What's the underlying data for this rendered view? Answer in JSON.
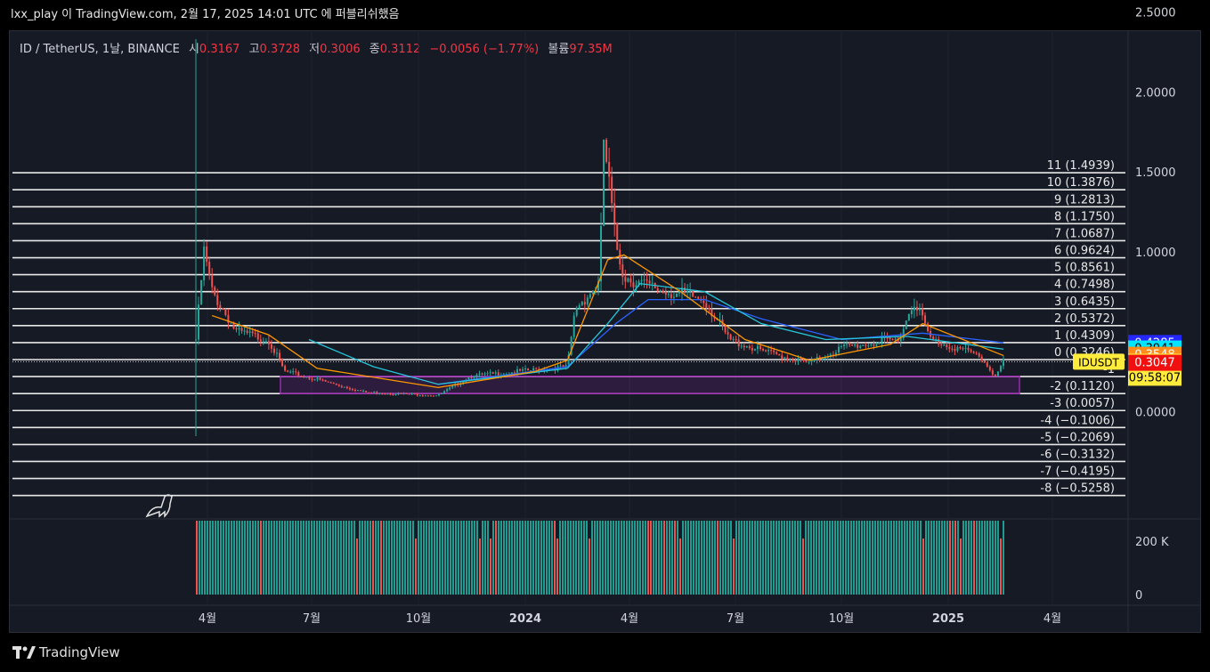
{
  "header": {
    "caption": "lxx_play 이 TradingView.com, 2월 17, 2025 14:01 UTC 에 퍼블리쉬했음"
  },
  "legend": {
    "symbol": "ID / TetherUS, 1날, BINANCE",
    "open_label": "시",
    "open": "0.3167",
    "high_label": "고",
    "high": "0.3728",
    "low_label": "저",
    "low": "0.3006",
    "close_label": "종",
    "close": "0.3112",
    "change": "−0.0056 (−1.77%)",
    "volume_label": "볼륨",
    "volume": "97.35M"
  },
  "footer": {
    "brand": "TradingView"
  },
  "colors": {
    "up": "#26a69a",
    "down": "#ef5350",
    "ma_fast": "#ff9800",
    "ma_slow": "#26c6da",
    "ma_long": "#2962ff",
    "box": "#9c27b0",
    "badge_label": "#ffeb3b"
  },
  "chart_data": {
    "type": "candlestick",
    "symbol": "IDUSDT",
    "price_axis": {
      "ticks": [
        "2.5000",
        "2.0000",
        "1.5000",
        "1.0000",
        "0.0000"
      ],
      "range": [
        -0.55,
        2.55
      ]
    },
    "volume_axis": {
      "ticks": [
        "200 K",
        "0"
      ]
    },
    "time_axis": {
      "ticks": [
        "4월",
        "7월",
        "10월",
        "2024",
        "4월",
        "7월",
        "10월",
        "2025",
        "4월"
      ]
    },
    "grid_levels": [
      {
        "label": "11 (1.4939)",
        "price": 1.4939
      },
      {
        "label": "10 (1.3876)",
        "price": 1.3876
      },
      {
        "label": "9 (1.2813)",
        "price": 1.2813
      },
      {
        "label": "8 (1.1750)",
        "price": 1.175
      },
      {
        "label": "7 (1.0687)",
        "price": 1.0687
      },
      {
        "label": "6 (0.9624)",
        "price": 0.9624
      },
      {
        "label": "5 (0.8561)",
        "price": 0.8561
      },
      {
        "label": "4 (0.7498)",
        "price": 0.7498
      },
      {
        "label": "3 (0.6435)",
        "price": 0.6435
      },
      {
        "label": "2 (0.5372)",
        "price": 0.5372
      },
      {
        "label": "1 (0.4309)",
        "price": 0.4309
      },
      {
        "label": "0 (0.3246)",
        "price": 0.3246
      },
      {
        "label": "-1",
        "price": 0.2183
      },
      {
        "label": "-2 (0.1120)",
        "price": 0.112
      },
      {
        "label": "-3 (0.0057)",
        "price": 0.0057
      },
      {
        "label": "-4 (−0.1006)",
        "price": -0.1006
      },
      {
        "label": "-5 (−0.2069)",
        "price": -0.2069
      },
      {
        "label": "-6 (−0.3132)",
        "price": -0.3132
      },
      {
        "label": "-7 (−0.4195)",
        "price": -0.4195
      },
      {
        "label": "-8 (−0.5258)",
        "price": -0.5258
      }
    ],
    "badges": [
      {
        "text": "0.4285",
        "price": 0.4285,
        "color": "#2626ff"
      },
      {
        "text": "0.3941",
        "price": 0.3941,
        "color": "#00e5ff"
      },
      {
        "text": "0.3548",
        "price": 0.3548,
        "color": "#ff8c1a"
      },
      {
        "text": "0.3112",
        "price": 0.3112,
        "color": "#ffeb3b",
        "sub": "09:58:07"
      },
      {
        "text": "0.3047",
        "price": 0.3047,
        "color": "#f01010"
      }
    ],
    "symbol_badge": "IDUSDT",
    "price_path": [
      [
        0,
        0.45
      ],
      [
        0.01,
        1.0
      ],
      [
        0.02,
        0.75
      ],
      [
        0.05,
        0.5
      ],
      [
        0.09,
        0.45
      ],
      [
        0.11,
        0.25
      ],
      [
        0.15,
        0.2
      ],
      [
        0.21,
        0.12
      ],
      [
        0.3,
        0.1
      ],
      [
        0.34,
        0.22
      ],
      [
        0.46,
        0.28
      ],
      [
        0.47,
        0.65
      ],
      [
        0.5,
        0.8
      ],
      [
        0.505,
        1.7
      ],
      [
        0.52,
        1.05
      ],
      [
        0.53,
        0.85
      ],
      [
        0.56,
        0.78
      ],
      [
        0.63,
        0.7
      ],
      [
        0.66,
        0.45
      ],
      [
        0.7,
        0.38
      ],
      [
        0.76,
        0.3
      ],
      [
        0.8,
        0.4
      ],
      [
        0.87,
        0.45
      ],
      [
        0.89,
        0.7
      ],
      [
        0.91,
        0.45
      ],
      [
        0.97,
        0.35
      ],
      [
        0.99,
        0.22
      ],
      [
        1.0,
        0.31
      ]
    ],
    "ma_fast": [
      [
        0.02,
        0.6
      ],
      [
        0.09,
        0.48
      ],
      [
        0.15,
        0.27
      ],
      [
        0.3,
        0.15
      ],
      [
        0.42,
        0.25
      ],
      [
        0.46,
        0.32
      ],
      [
        0.51,
        0.95
      ],
      [
        0.53,
        0.98
      ],
      [
        0.6,
        0.75
      ],
      [
        0.68,
        0.45
      ],
      [
        0.76,
        0.32
      ],
      [
        0.86,
        0.42
      ],
      [
        0.9,
        0.55
      ],
      [
        0.96,
        0.43
      ],
      [
        1.0,
        0.35
      ]
    ],
    "ma_slow": [
      [
        0.14,
        0.45
      ],
      [
        0.22,
        0.28
      ],
      [
        0.3,
        0.17
      ],
      [
        0.46,
        0.27
      ],
      [
        0.51,
        0.55
      ],
      [
        0.55,
        0.8
      ],
      [
        0.63,
        0.75
      ],
      [
        0.7,
        0.55
      ],
      [
        0.78,
        0.45
      ],
      [
        0.88,
        0.47
      ],
      [
        1.0,
        0.39
      ]
    ],
    "ma_long": [
      [
        0.3,
        0.17
      ],
      [
        0.46,
        0.28
      ],
      [
        0.52,
        0.55
      ],
      [
        0.56,
        0.7
      ],
      [
        0.63,
        0.7
      ],
      [
        0.7,
        0.58
      ],
      [
        0.8,
        0.45
      ],
      [
        0.9,
        0.49
      ],
      [
        1.0,
        0.43
      ]
    ],
    "volume": {
      "max_label_value": 200000
    }
  }
}
